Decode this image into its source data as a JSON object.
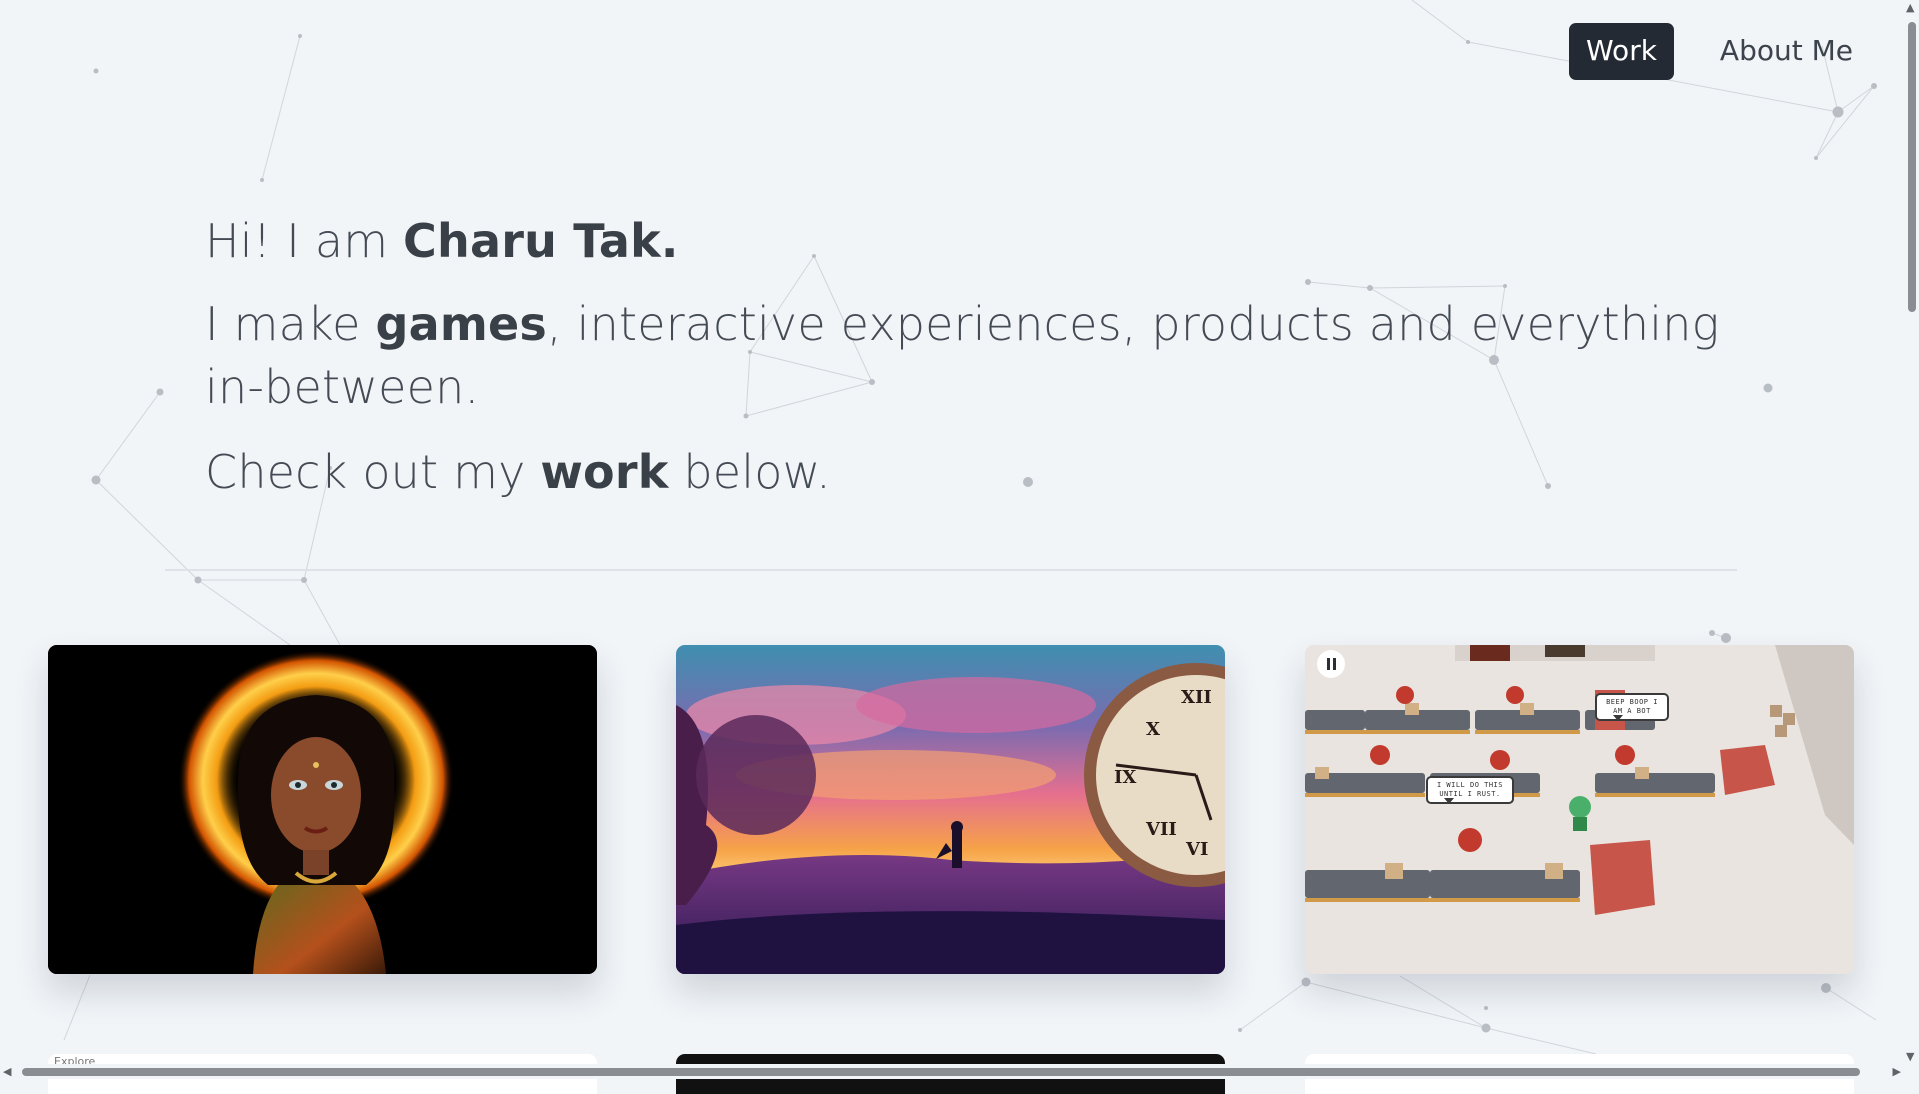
{
  "nav": {
    "items": [
      {
        "label": "Work",
        "active": true
      },
      {
        "label": "About Me",
        "active": false
      }
    ]
  },
  "hero": {
    "line1": {
      "pre": "Hi! I am ",
      "name": "Charu Tak."
    },
    "line2": {
      "pre": "I make ",
      "bold": "games",
      "post": ", interactive experiences, products and everything in-between."
    },
    "line3": {
      "pre": "Check out my ",
      "bold": "work",
      "post": " below."
    }
  },
  "projects": [
    {
      "media": "illustration-woman-fire-halo"
    },
    {
      "media": "illustration-sunset-clock"
    },
    {
      "media": "game-3d-office-scene",
      "bubbles": [
        "I WILL DO THIS UNTIL I RUST.",
        "BEEP BOOP I AM A BOT"
      ]
    }
  ],
  "next_row_peek": {
    "label": "Explore"
  },
  "colors": {
    "nav_active_bg": "#232a33",
    "background": "#f1f5f8",
    "text": "#454b55"
  }
}
